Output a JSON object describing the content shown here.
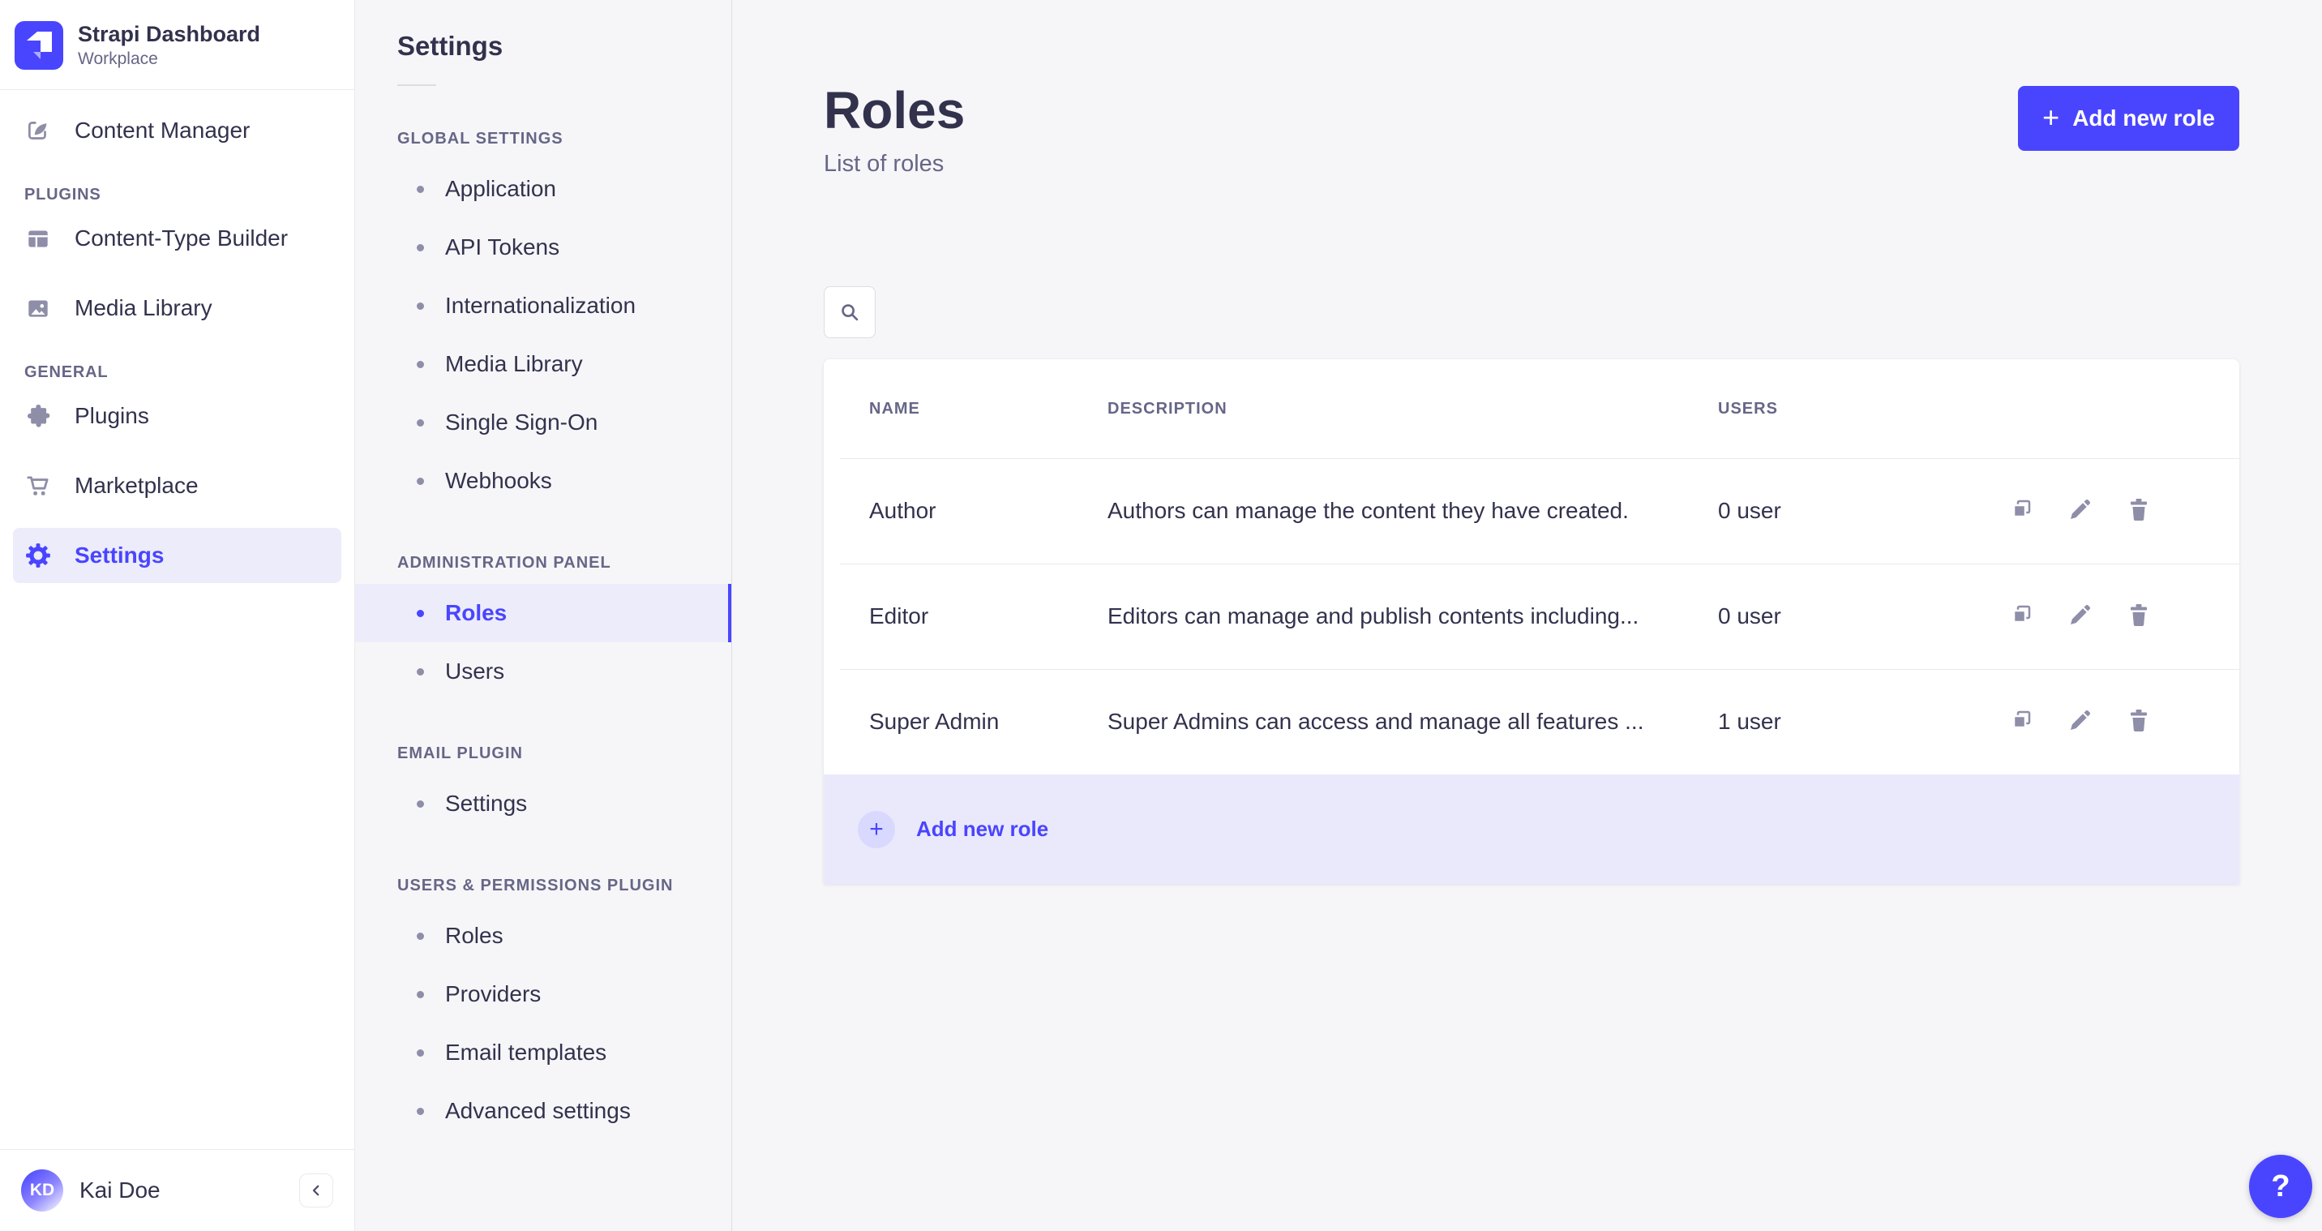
{
  "colors": {
    "accent": "#4945ff",
    "accent_light_bg": "#ececfb",
    "footer_row_bg": "#eae9fc",
    "plus_circle_bg": "#d9d8ff",
    "text_dark": "#32324d",
    "text_muted": "#666687",
    "icon_gray": "#8e8ea9",
    "border": "#eaeaef",
    "page_bg": "#f6f6f9"
  },
  "icons": {
    "logo": "strapi-logo",
    "content_manager": "feather-pen",
    "content_type_builder": "layout-grid",
    "media_library": "picture",
    "plugins": "puzzle-piece",
    "marketplace": "shopping-cart",
    "settings": "gear",
    "search": "magnifier",
    "duplicate": "copy",
    "edit": "pencil",
    "delete": "trash",
    "collapse": "chevron-left",
    "plus_glyph": "+",
    "help_glyph": "?"
  },
  "sidebar": {
    "brand": {
      "title": "Strapi Dashboard",
      "subtitle": "Workplace"
    },
    "content_manager_label": "Content Manager",
    "sections": [
      {
        "header": "PLUGINS",
        "items": [
          {
            "label": "Content-Type Builder"
          },
          {
            "label": "Media Library"
          }
        ]
      },
      {
        "header": "GENERAL",
        "items": [
          {
            "label": "Plugins"
          },
          {
            "label": "Marketplace"
          },
          {
            "label": "Settings",
            "active": true
          }
        ]
      }
    ],
    "user": {
      "initials": "KD",
      "name": "Kai Doe"
    }
  },
  "subnav": {
    "title": "Settings",
    "active_item": "Roles",
    "groups": [
      {
        "header": "GLOBAL SETTINGS",
        "items": [
          "Application",
          "API Tokens",
          "Internationalization",
          "Media Library",
          "Single Sign-On",
          "Webhooks"
        ]
      },
      {
        "header": "ADMINISTRATION PANEL",
        "items": [
          "Roles",
          "Users"
        ]
      },
      {
        "header": "EMAIL PLUGIN",
        "items": [
          "Settings"
        ]
      },
      {
        "header": "USERS & PERMISSIONS PLUGIN",
        "items": [
          "Roles",
          "Providers",
          "Email templates",
          "Advanced settings"
        ]
      }
    ]
  },
  "main": {
    "page_title": "Roles",
    "page_subtitle": "List of roles",
    "add_button_label": "Add new role",
    "table": {
      "headers": [
        "NAME",
        "DESCRIPTION",
        "USERS"
      ],
      "rows": [
        {
          "name": "Author",
          "description": "Authors can manage the content they have created.",
          "users": "0 user"
        },
        {
          "name": "Editor",
          "description": "Editors can manage and publish contents including...",
          "users": "0 user"
        },
        {
          "name": "Super Admin",
          "description": "Super Admins can access and manage all features ...",
          "users": "1 user"
        }
      ]
    },
    "footer_add_label": "Add new role",
    "help_label": "?"
  }
}
